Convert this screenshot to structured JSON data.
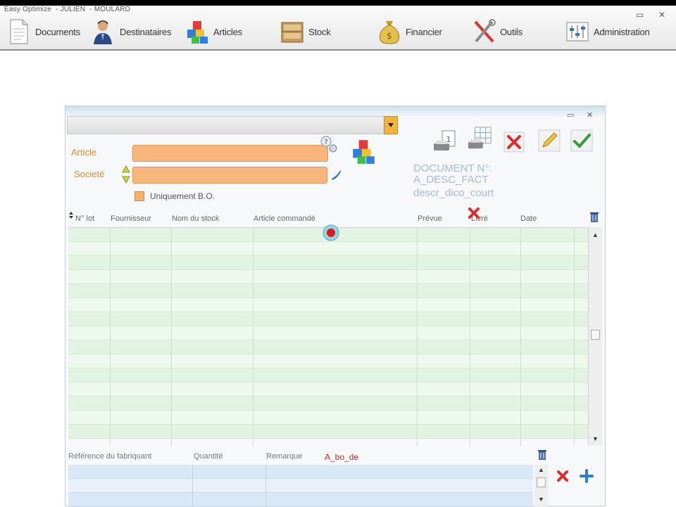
{
  "app": {
    "title_parts": [
      "Easy Optimize",
      "JULIEN",
      "MOULARD"
    ],
    "nav": [
      {
        "label": "Documents",
        "icon": "document-icon"
      },
      {
        "label": "Destinataires",
        "icon": "person-icon"
      },
      {
        "label": "Articles",
        "icon": "blocks-icon"
      },
      {
        "label": "Stock",
        "icon": "shelf-icon"
      },
      {
        "label": "Financier",
        "icon": "money-bag-icon"
      },
      {
        "label": "Outils",
        "icon": "tools-icon"
      },
      {
        "label": "Administration",
        "icon": "sliders-icon"
      }
    ]
  },
  "form": {
    "article_label": "Article",
    "societe_label": "Societé",
    "article_value": "",
    "societe_value": "",
    "checkbox_label": "Uniquement B.O.",
    "document_lines": [
      "DOCUMENT N°:",
      "A_DESC_FACT",
      "descr_dico_court"
    ]
  },
  "grid": {
    "columns": [
      "N° lot",
      "Fournisseur",
      "Nom du stock",
      "Article commandé",
      "Prévue",
      "Livré",
      "Date"
    ],
    "row_count": 15
  },
  "lower_grid": {
    "columns": [
      "Référence du fabriquant",
      "Quantité",
      "Remarque"
    ],
    "red_label": "A_bo_de",
    "row_count": 3
  },
  "colors": {
    "field_orange": "#f8b57c",
    "label_orange": "#e48a30",
    "grid_green": "#e3f3e2",
    "grid_blue": "#d9e8f7",
    "doc_text": "#a7b8e0"
  }
}
